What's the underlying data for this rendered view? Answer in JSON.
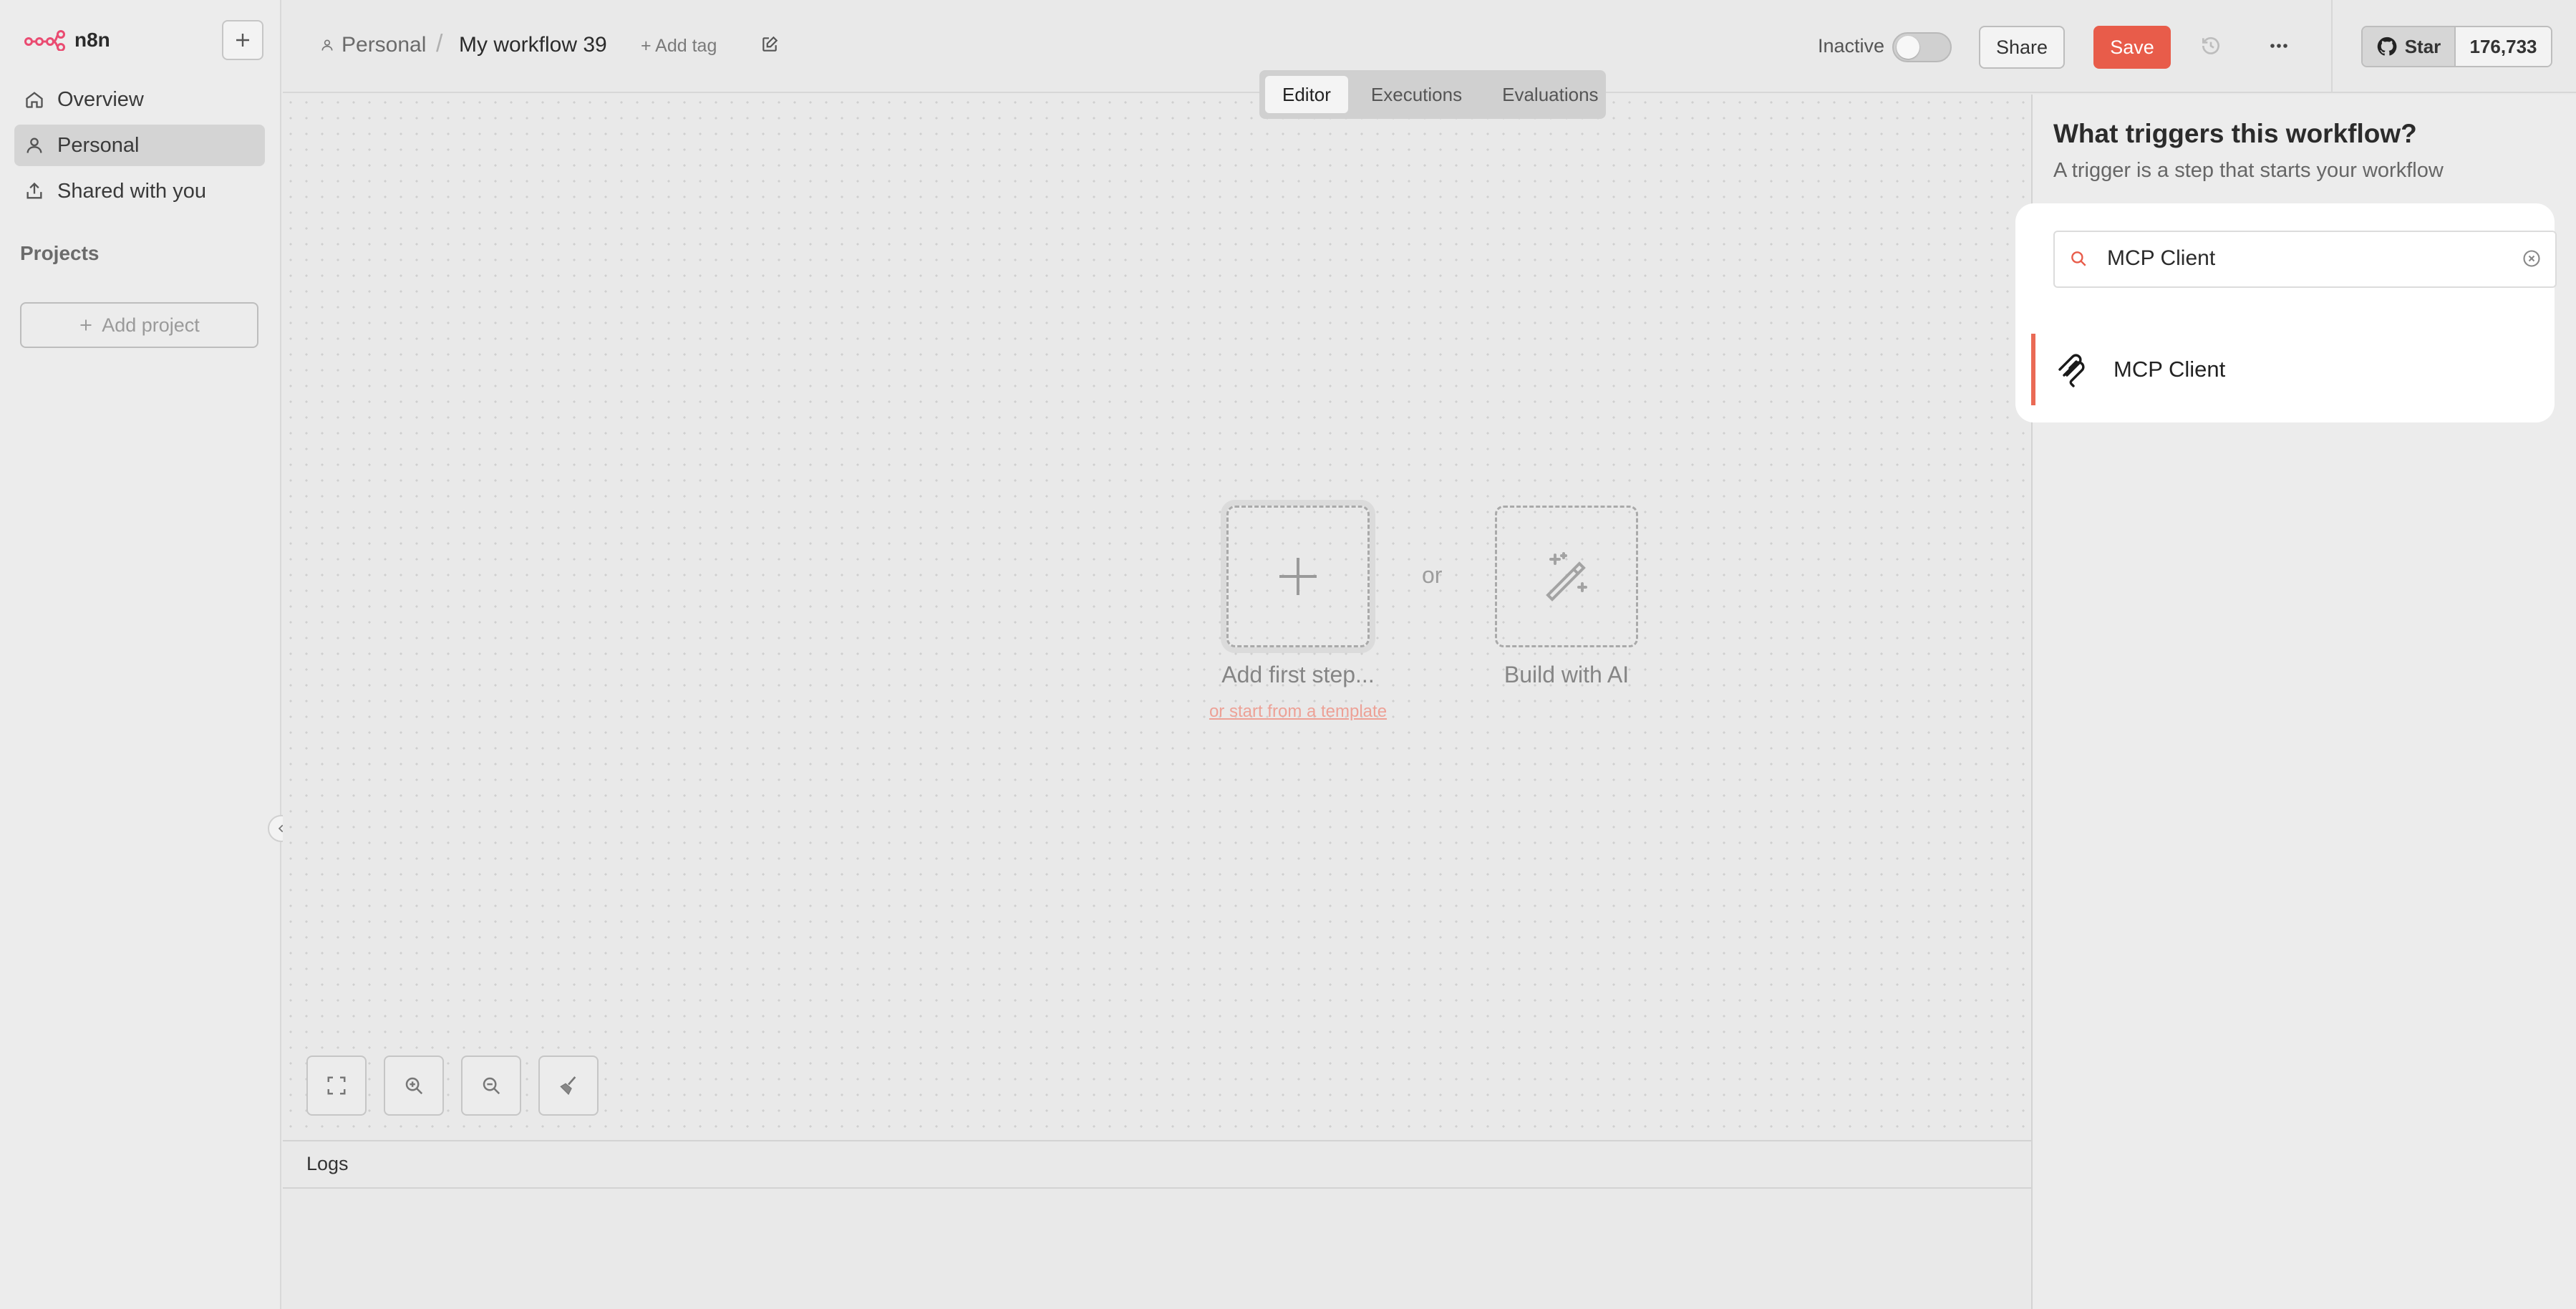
{
  "app": {
    "logo_text": "n8n"
  },
  "sidebar": {
    "items": [
      {
        "label": "Overview",
        "icon": "home-icon"
      },
      {
        "label": "Personal",
        "icon": "user-icon",
        "active": true
      },
      {
        "label": "Shared with you",
        "icon": "share-icon"
      }
    ],
    "projects_label": "Projects",
    "add_project_label": "Add project"
  },
  "header": {
    "project": "Personal",
    "separator": "/",
    "workflow_name": "My workflow 39",
    "add_tag": "+ Add tag",
    "status_label": "Inactive",
    "share_label": "Share",
    "save_label": "Save",
    "star_label": "Star",
    "star_count": "176,733"
  },
  "tabs": [
    {
      "label": "Editor",
      "active": true
    },
    {
      "label": "Executions"
    },
    {
      "label": "Evaluations"
    }
  ],
  "canvas": {
    "add_first_step": "Add first step...",
    "template_link": "or start from a template",
    "or_label": "or",
    "build_with_ai": "Build with AI"
  },
  "logs": {
    "label": "Logs"
  },
  "panel": {
    "title": "What triggers this workflow?",
    "subtitle": "A trigger is a step that starts your workflow",
    "search_value": "MCP Client",
    "results": [
      {
        "label": "MCP Client",
        "icon": "mcp-icon"
      }
    ]
  },
  "colors": {
    "accent": "#e85c4a",
    "brand": "#ea4b71"
  }
}
